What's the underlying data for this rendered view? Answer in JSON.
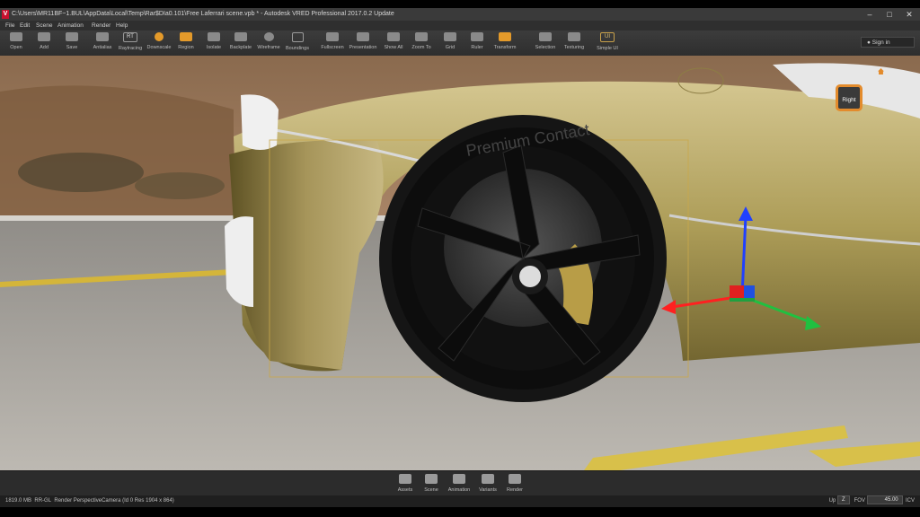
{
  "window": {
    "app_icon": "V",
    "title": "C:\\Users\\MR11BF~1.BUL\\AppData\\Local\\Temp\\Rar$DIa0.101\\Free Laferrari scene.vpb * - Autodesk VRED Professional 2017.0.2 Update",
    "controls": [
      "–",
      "□",
      "✕"
    ]
  },
  "menu": [
    "File",
    "Edit",
    "Scene",
    "Animation",
    "Render",
    "Help"
  ],
  "toolbar": [
    {
      "label": "Open",
      "icon": "folder-icon"
    },
    {
      "label": "Add",
      "icon": "add-file-icon"
    },
    {
      "label": "Save",
      "icon": "save-icon"
    },
    {
      "label": "Antialias",
      "icon": "antialias-icon"
    },
    {
      "label": "Raytracing",
      "icon": "raytracing-icon",
      "text": "RT"
    },
    {
      "label": "Downscale",
      "icon": "downscale-icon"
    },
    {
      "label": "Region",
      "icon": "region-icon"
    },
    {
      "label": "Isolate",
      "icon": "isolate-icon"
    },
    {
      "label": "Backplate",
      "icon": "backplate-icon"
    },
    {
      "label": "Wireframe",
      "icon": "wireframe-icon"
    },
    {
      "label": "Boundings",
      "icon": "boundings-icon"
    },
    {
      "label": "Fullscreen",
      "icon": "fullscreen-icon"
    },
    {
      "label": "Presentation",
      "icon": "presentation-icon"
    },
    {
      "label": "Show All",
      "icon": "show-all-icon"
    },
    {
      "label": "Zoom To",
      "icon": "zoom-to-icon"
    },
    {
      "label": "Grid",
      "icon": "grid-icon"
    },
    {
      "label": "Ruler",
      "icon": "ruler-icon"
    },
    {
      "label": "Transform",
      "icon": "transform-icon"
    },
    {
      "label": "Selection",
      "icon": "selection-icon"
    },
    {
      "label": "Texturing",
      "icon": "texturing-icon"
    },
    {
      "label": "Simple UI",
      "icon": "simple-ui-icon",
      "text": "UI"
    }
  ],
  "signin": {
    "label": "Sign in",
    "icon": "user-icon"
  },
  "viewport": {
    "navcube_label": "Right"
  },
  "dock": [
    {
      "label": "Assets",
      "icon": "assets-icon"
    },
    {
      "label": "Scene",
      "icon": "scene-icon"
    },
    {
      "label": "Animation",
      "icon": "animation-icon"
    },
    {
      "label": "Variants",
      "icon": "variants-icon"
    },
    {
      "label": "Render",
      "icon": "camera-icon"
    }
  ],
  "status": {
    "memory": "1819.0 MB",
    "renderer": "RR-GL",
    "camera": "Render PerspectiveCamera (Id 0 Res 1904 x 864)",
    "up_label": "Up",
    "up_value": "Z",
    "fov_label": "FOV",
    "fov_value": "45.00",
    "icp_label": "ICV"
  },
  "tire_text": "Premium Contact"
}
